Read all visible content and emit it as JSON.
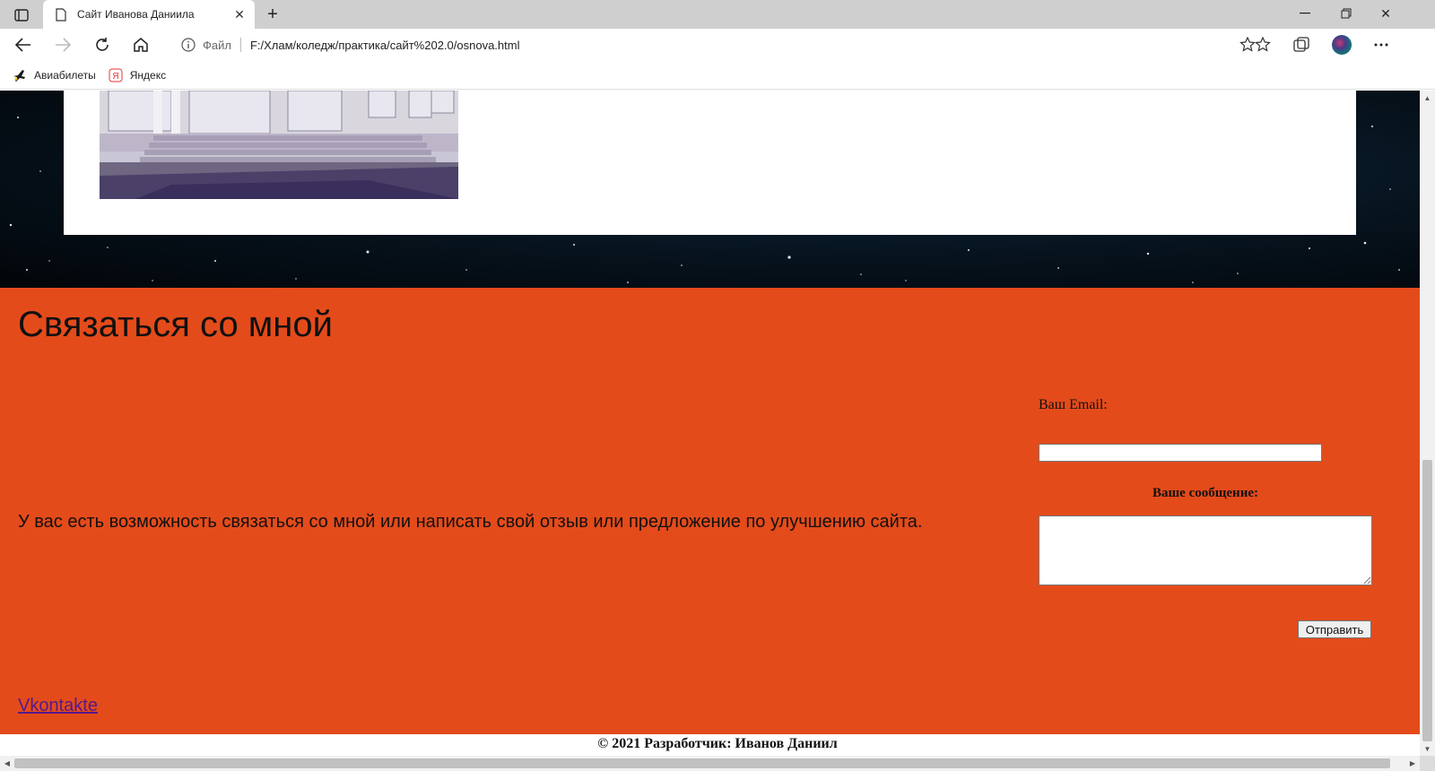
{
  "browser": {
    "tab_title": "Сайт Иванова Даниила",
    "new_tab_label": "+",
    "address": {
      "protocol_label": "Файл",
      "url": "F:/Хлам/коледж/практика/сайт%202.0/osnova.html"
    },
    "bookmarks": [
      {
        "label": "Авиабилеты",
        "icon": "plane-icon"
      },
      {
        "label": "Яндекс",
        "icon": "yandex-icon"
      }
    ]
  },
  "page": {
    "contact": {
      "heading": "Связаться со мной",
      "description": "У вас есть возможность связаться со мной или написать свой отзыв или предложение по улучшению сайта.",
      "vk_link": "Vkontakte"
    },
    "form": {
      "email_label": "Ваш Email:",
      "email_value": "",
      "message_label": "Ваше сообщение:",
      "message_value": "",
      "submit_label": "Отправить"
    },
    "footer": {
      "copyright": "© 2021 Разработчик: Иванов Даниил"
    }
  },
  "colors": {
    "contact_bg": "#e44b1b",
    "link": "#551a8b"
  }
}
